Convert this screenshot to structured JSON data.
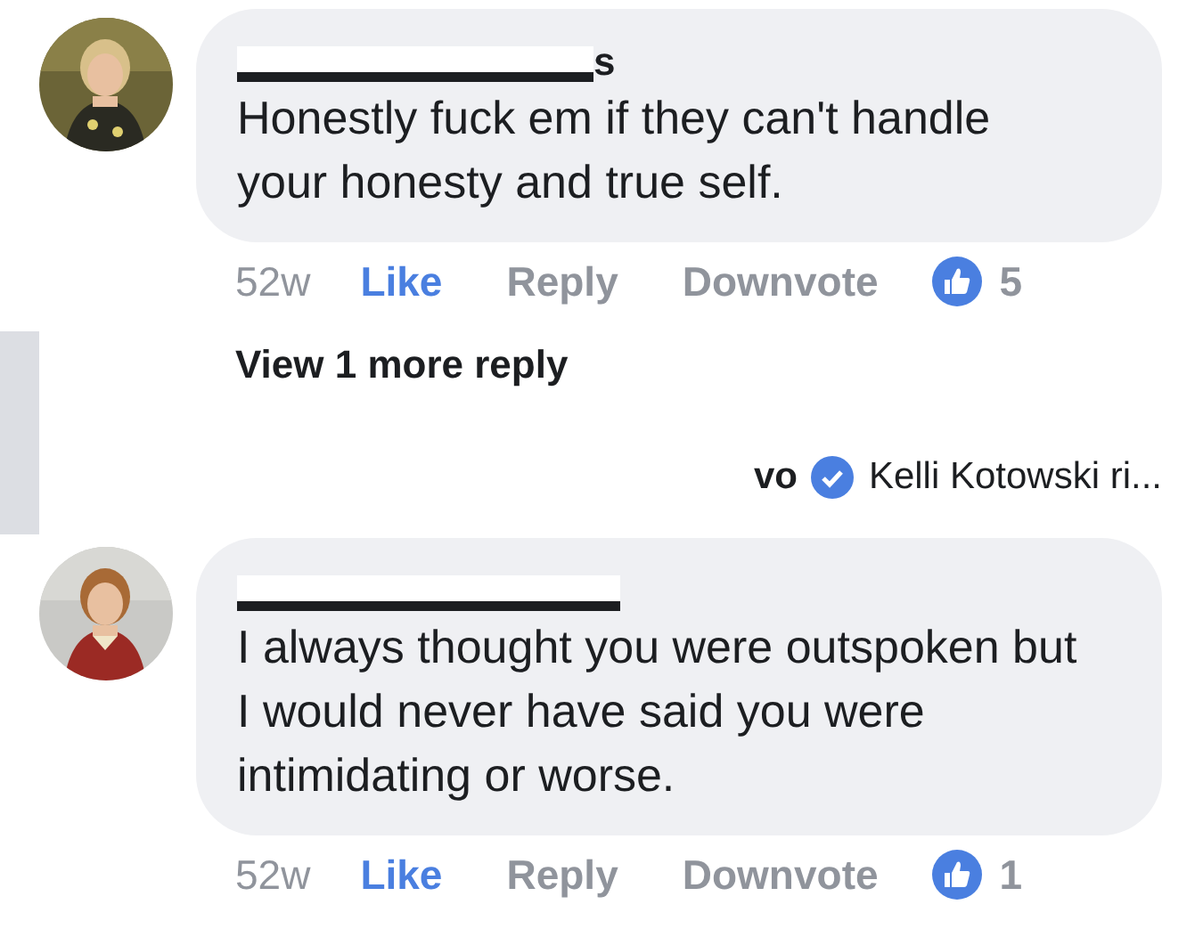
{
  "comments": [
    {
      "author_redacted": true,
      "author_visible_end": "s",
      "text": "Honestly fuck em if they can't handle your honesty and true self.",
      "time": "52w",
      "actions": [
        {
          "label": "Like",
          "selected": true
        },
        {
          "label": "Reply",
          "selected": false
        },
        {
          "label": "Downvote",
          "selected": false
        }
      ],
      "reactions": "5",
      "more_replies": {
        "label": "View 1 more reply",
        "preview_author_end": "vo",
        "verified": true,
        "preview_text": "Kelli Kotowski ri..."
      }
    },
    {
      "author_redacted": true,
      "text": "I always thought you were outspoken but I would never have said you were intimidating or worse.",
      "time": "52w",
      "actions": [
        {
          "label": "Like",
          "selected": true
        },
        {
          "label": "Reply",
          "selected": false
        },
        {
          "label": "Downvote",
          "selected": false
        }
      ],
      "reactions": "1"
    }
  ]
}
